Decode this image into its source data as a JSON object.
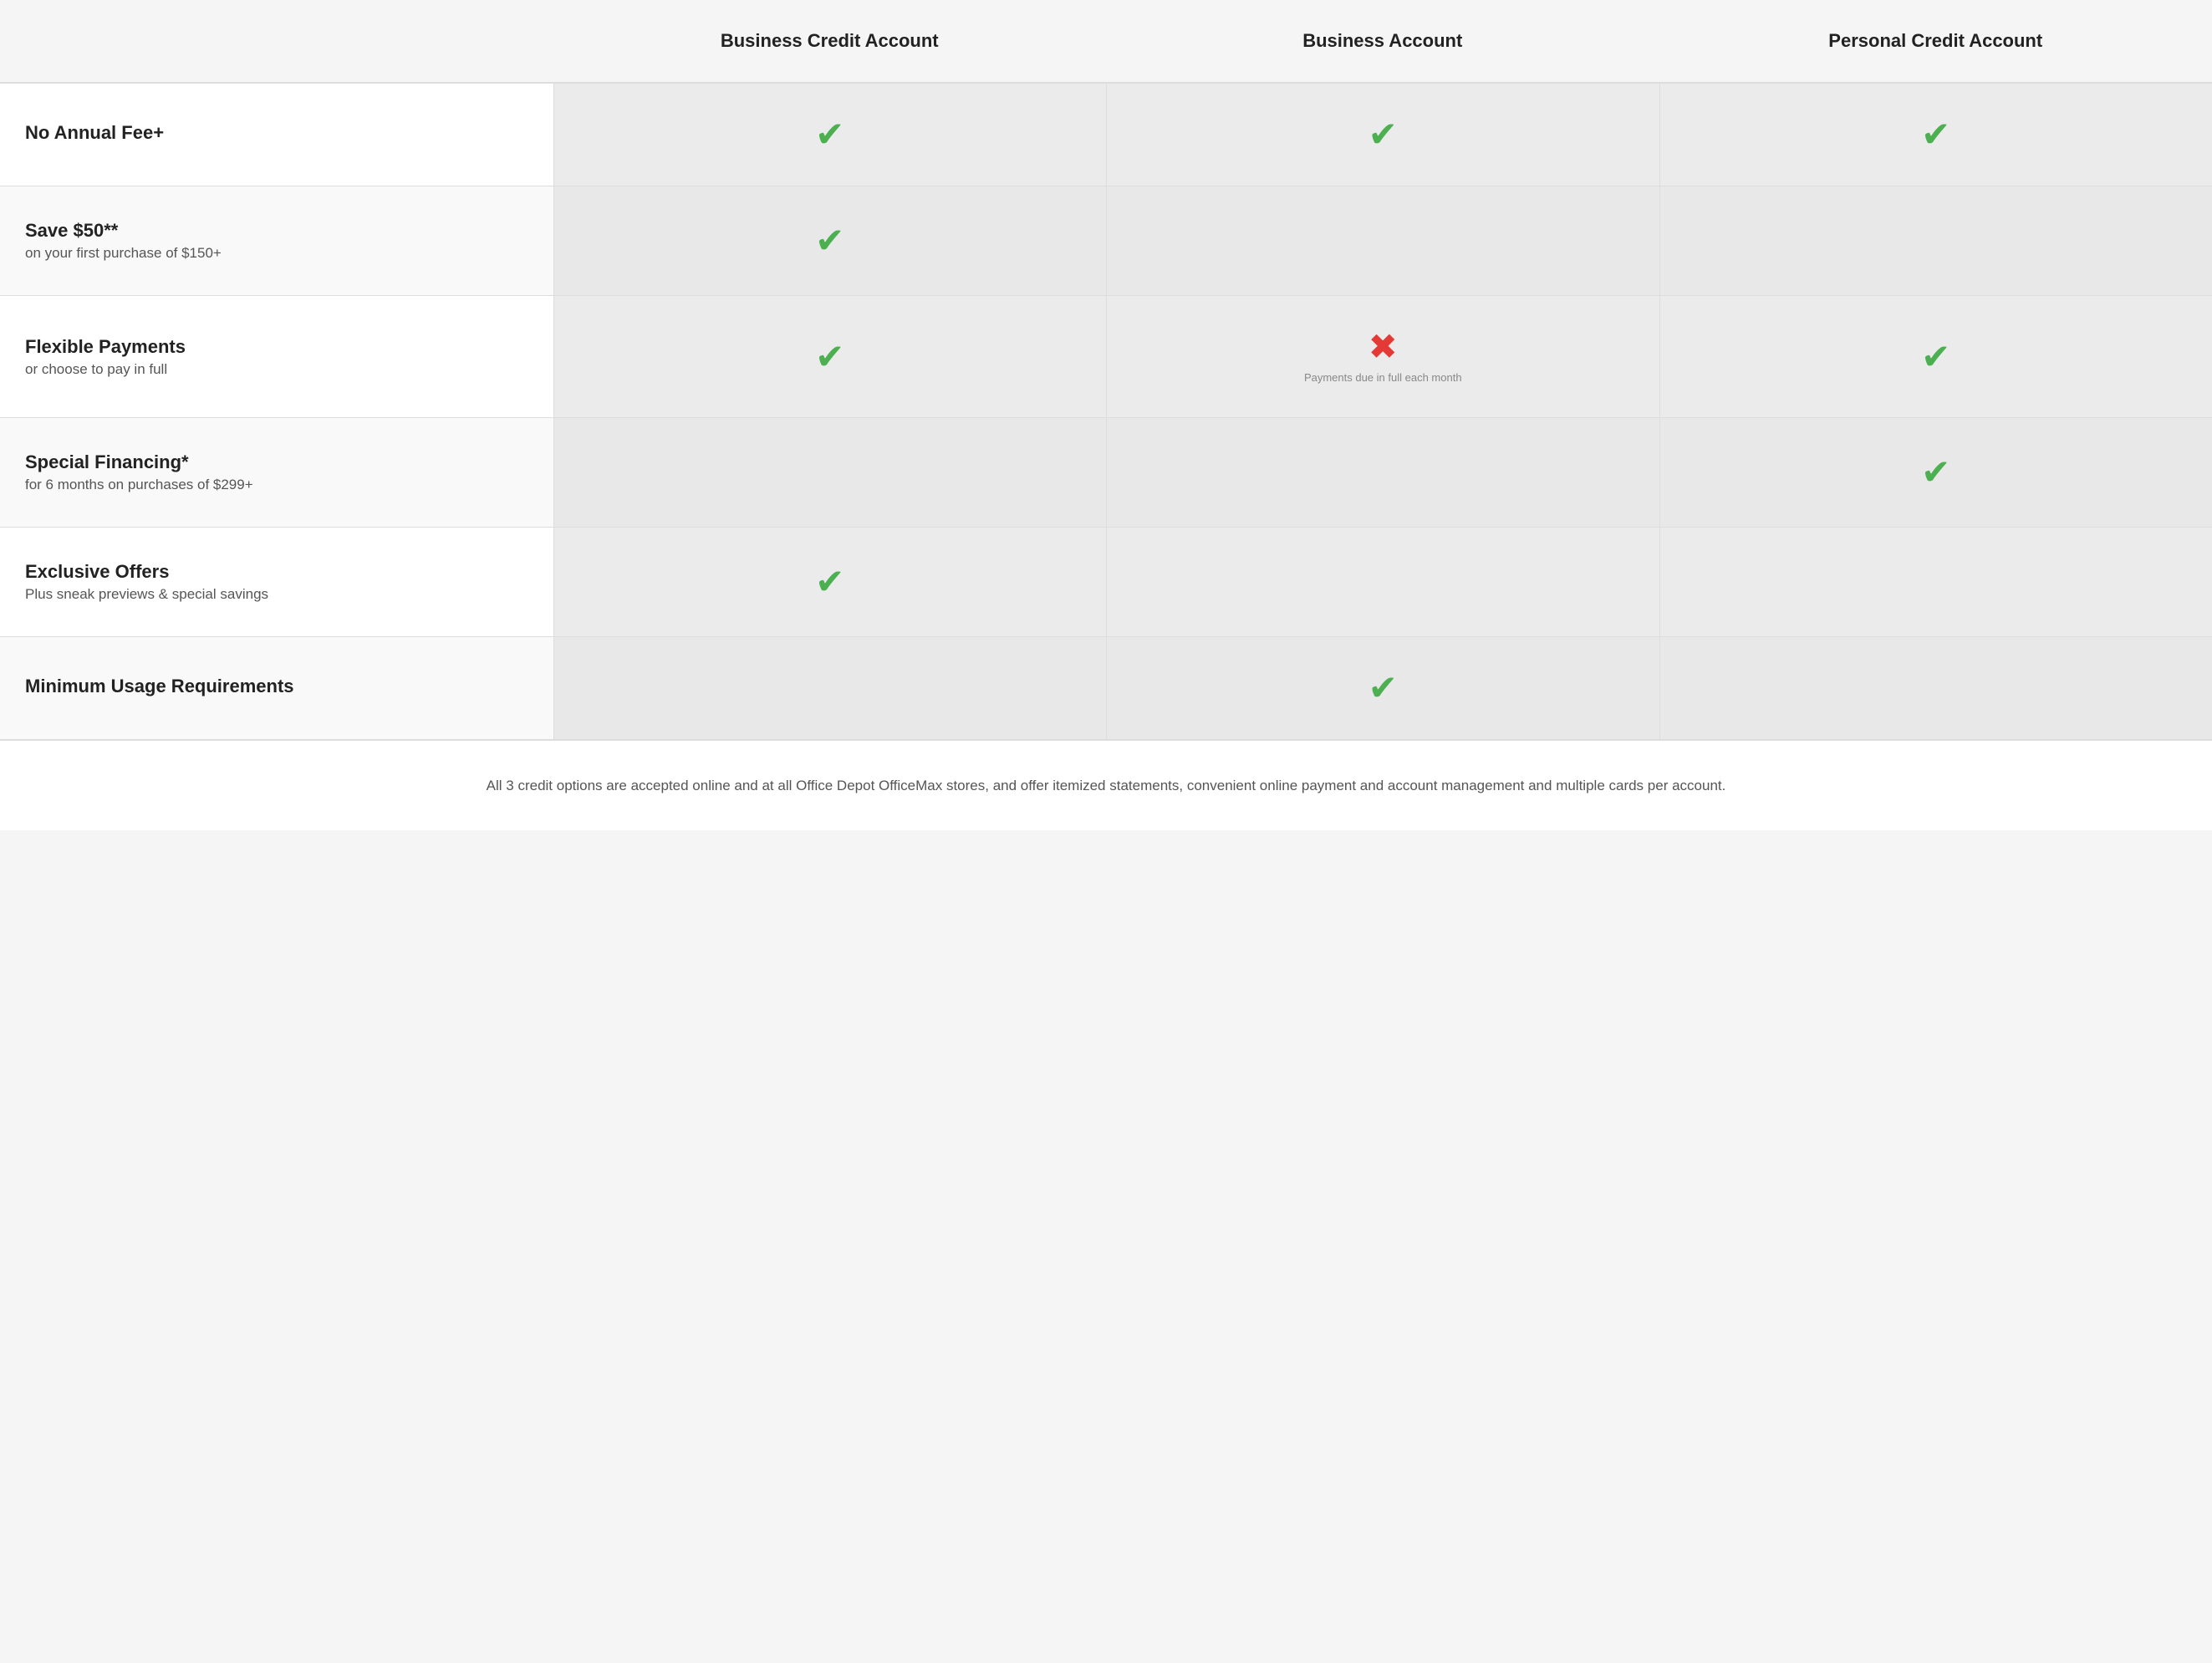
{
  "header": {
    "col1": "",
    "col2": "Business Credit Account",
    "col3": "Business Account",
    "col4": "Personal Credit Account"
  },
  "rows": [
    {
      "id": "no-annual-fee",
      "title": "No Annual Fee",
      "superscript": "+",
      "subtitle": "",
      "col2": "check",
      "col3": "check",
      "col4": "check",
      "col2_note": "",
      "col3_note": "",
      "col4_note": ""
    },
    {
      "id": "save-50",
      "title": "Save $50",
      "superscript": "**",
      "subtitle": "on your first purchase of $150+",
      "col2": "check",
      "col3": "empty",
      "col4": "empty",
      "col2_note": "",
      "col3_note": "",
      "col4_note": ""
    },
    {
      "id": "flexible-payments",
      "title": "Flexible Payments",
      "superscript": "",
      "subtitle": "or choose to pay in full",
      "col2": "check",
      "col3": "cross",
      "col4": "check",
      "col2_note": "",
      "col3_note": "Payments due in full each month",
      "col4_note": ""
    },
    {
      "id": "special-financing",
      "title": "Special Financing",
      "superscript": "*",
      "subtitle": "for 6 months on purchases of $299+",
      "col2": "empty",
      "col3": "empty",
      "col4": "check",
      "col2_note": "",
      "col3_note": "",
      "col4_note": ""
    },
    {
      "id": "exclusive-offers",
      "title": "Exclusive Offers",
      "superscript": "",
      "subtitle": "Plus sneak previews & special savings",
      "col2": "check",
      "col3": "empty",
      "col4": "empty",
      "col2_note": "",
      "col3_note": "",
      "col4_note": ""
    },
    {
      "id": "minimum-usage",
      "title": "Minimum Usage Requirements",
      "superscript": "",
      "subtitle": "",
      "col2": "empty",
      "col3": "check",
      "col4": "empty",
      "col2_note": "",
      "col3_note": "",
      "col4_note": ""
    }
  ],
  "footer": {
    "text": "All 3 credit options are accepted online and at all Office Depot OfficeMax stores, and offer itemized statements, convenient online payment and account management and multiple cards per account."
  },
  "icons": {
    "check": "✔",
    "cross": "✖"
  }
}
